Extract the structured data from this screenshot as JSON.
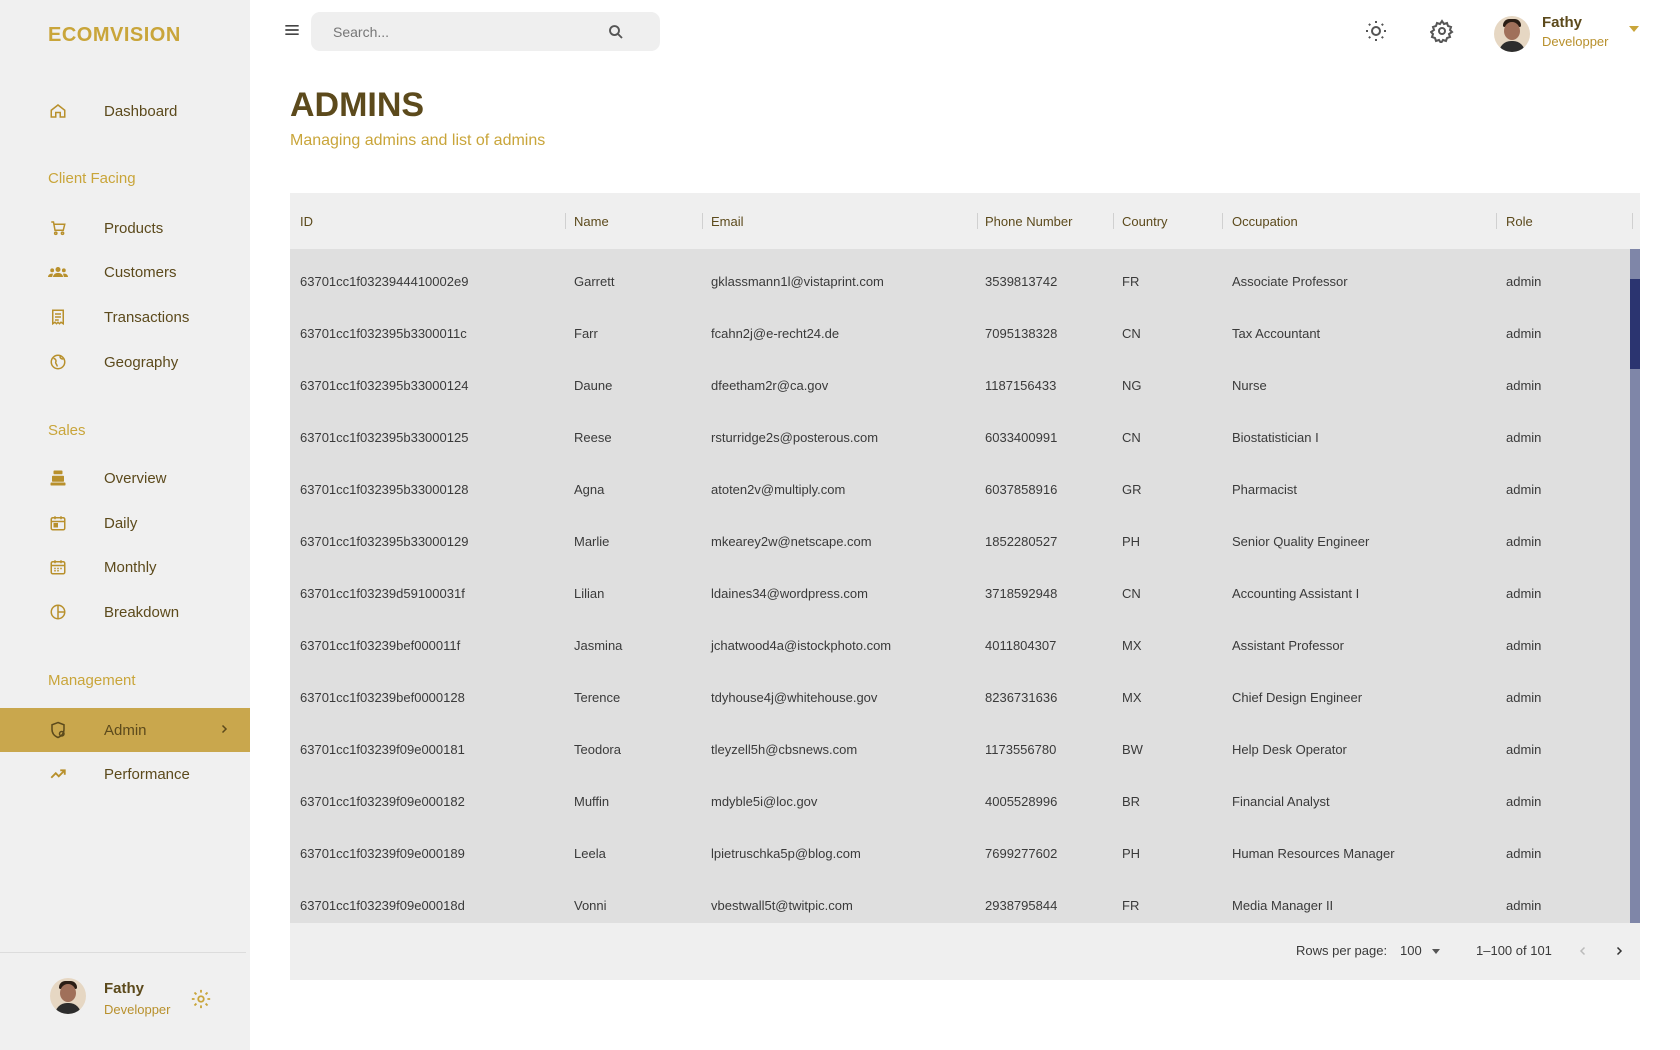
{
  "brand": "ECOMVISION",
  "nav": {
    "dashboard": "Dashboard",
    "client_section": "Client Facing",
    "products": "Products",
    "customers": "Customers",
    "transactions": "Transactions",
    "geography": "Geography",
    "sales_section": "Sales",
    "overview": "Overview",
    "daily": "Daily",
    "monthly": "Monthly",
    "breakdown": "Breakdown",
    "management_section": "Management",
    "admin": "Admin",
    "performance": "Performance"
  },
  "user": {
    "name": "Fathy",
    "role": "Developper"
  },
  "search": {
    "placeholder": "Search..."
  },
  "header": {
    "title": "ADMINS",
    "subtitle": "Managing admins and list of admins"
  },
  "table": {
    "columns": [
      "ID",
      "Name",
      "Email",
      "Phone Number",
      "Country",
      "Occupation",
      "Role"
    ],
    "rows": [
      [
        "63701cc1f0323944410002e9",
        "Garrett",
        "gklassmann1l@vistaprint.com",
        "3539813742",
        "FR",
        "Associate Professor",
        "admin"
      ],
      [
        "63701cc1f032395b3300011c",
        "Farr",
        "fcahn2j@e-recht24.de",
        "7095138328",
        "CN",
        "Tax Accountant",
        "admin"
      ],
      [
        "63701cc1f032395b33000124",
        "Daune",
        "dfeetham2r@ca.gov",
        "1187156433",
        "NG",
        "Nurse",
        "admin"
      ],
      [
        "63701cc1f032395b33000125",
        "Reese",
        "rsturridge2s@posterous.com",
        "6033400991",
        "CN",
        "Biostatistician I",
        "admin"
      ],
      [
        "63701cc1f032395b33000128",
        "Agna",
        "atoten2v@multiply.com",
        "6037858916",
        "GR",
        "Pharmacist",
        "admin"
      ],
      [
        "63701cc1f032395b33000129",
        "Marlie",
        "mkearey2w@netscape.com",
        "1852280527",
        "PH",
        "Senior Quality Engineer",
        "admin"
      ],
      [
        "63701cc1f03239d59100031f",
        "Lilian",
        "ldaines34@wordpress.com",
        "3718592948",
        "CN",
        "Accounting Assistant I",
        "admin"
      ],
      [
        "63701cc1f03239bef000011f",
        "Jasmina",
        "jchatwood4a@istockphoto.com",
        "4011804307",
        "MX",
        "Assistant Professor",
        "admin"
      ],
      [
        "63701cc1f03239bef0000128",
        "Terence",
        "tdyhouse4j@whitehouse.gov",
        "8236731636",
        "MX",
        "Chief Design Engineer",
        "admin"
      ],
      [
        "63701cc1f03239f09e000181",
        "Teodora",
        "tleyzell5h@cbsnews.com",
        "1173556780",
        "BW",
        "Help Desk Operator",
        "admin"
      ],
      [
        "63701cc1f03239f09e000182",
        "Muffin",
        "mdyble5i@loc.gov",
        "4005528996",
        "BR",
        "Financial Analyst",
        "admin"
      ],
      [
        "63701cc1f03239f09e000189",
        "Leela",
        "lpietruschka5p@blog.com",
        "7699277602",
        "PH",
        "Human Resources Manager",
        "admin"
      ],
      [
        "63701cc1f03239f09e00018d",
        "Vonni",
        "vbestwall5t@twitpic.com",
        "2938795844",
        "FR",
        "Media Manager II",
        "admin"
      ]
    ]
  },
  "pagination": {
    "rows_label": "Rows per page:",
    "rows_value": "100",
    "range": "1–100 of 101"
  },
  "colors": {
    "accent": "#c9a74d",
    "brand": "#c9a53a",
    "title": "#5c4a1c",
    "scroll_thumb": "#2b3470",
    "scroll_track": "#7f86a8"
  },
  "icons": {
    "nav": [
      "home-icon",
      "cart-icon",
      "groups-icon",
      "receipt-icon",
      "globe-icon",
      "point-of-sale-icon",
      "today-icon",
      "calendar-month-icon",
      "pie-chart-icon",
      "admin-icon",
      "trending-up-icon"
    ],
    "topbar": [
      "menu-icon",
      "search-icon",
      "light-mode-icon",
      "settings-icon",
      "arrow-drop-down-icon"
    ]
  }
}
